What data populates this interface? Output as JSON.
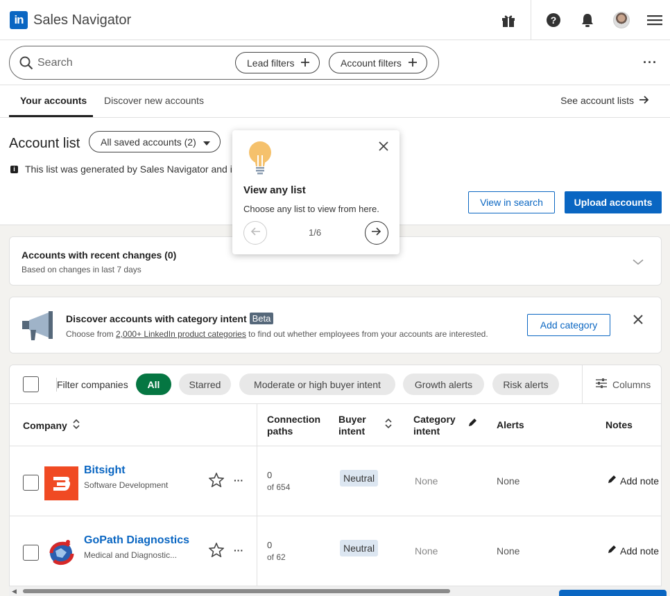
{
  "topbar": {
    "logo_text": "in",
    "app_title": "Sales Navigator"
  },
  "search": {
    "placeholder": "Search",
    "lead_filters": "Lead filters",
    "account_filters": "Account filters"
  },
  "tabs": {
    "your_accounts": "Your accounts",
    "discover": "Discover new accounts",
    "see_lists": "See account lists"
  },
  "account_list": {
    "title": "Account list",
    "dropdown_label": "All saved accounts (2)",
    "info_text": "This list was generated by Sales Navigator and in",
    "view_in_search": "View in search",
    "upload_accounts": "Upload accounts"
  },
  "popover": {
    "title": "View any list",
    "body": "Choose any list to view from here.",
    "counter": "1/6"
  },
  "recent_changes": {
    "title": "Accounts with recent changes (0)",
    "subtitle": "Based on changes in last 7 days"
  },
  "category_intent": {
    "title": "Discover accounts with category intent",
    "badge": "Beta",
    "sub_prefix": "Choose from ",
    "sub_link": "2,000+ LinkedIn product categories",
    "sub_suffix": " to find out whether employees from your accounts are interested.",
    "add_button": "Add category"
  },
  "filters": {
    "label": "Filter companies",
    "chips": [
      "All",
      "Starred",
      "Moderate or high buyer intent",
      "Growth alerts",
      "Risk alerts"
    ],
    "columns_label": "Columns"
  },
  "table": {
    "headers": {
      "company": "Company",
      "connection_paths": [
        "Connection",
        "paths"
      ],
      "buyer_intent": [
        "Buyer",
        "intent"
      ],
      "category_intent": [
        "Category",
        "intent"
      ],
      "alerts": "Alerts",
      "notes": "Notes"
    },
    "rows": [
      {
        "name": "Bitsight",
        "industry": "Software Development",
        "connections": "0",
        "connections_of": "of 654",
        "buyer_intent": "Neutral",
        "category_intent": "None",
        "alerts": "None",
        "note_action": "Add note"
      },
      {
        "name": "GoPath Diagnostics",
        "industry": "Medical and Diagnostic...",
        "connections": "0",
        "connections_of": "of 62",
        "buyer_intent": "Neutral",
        "category_intent": "None",
        "alerts": "None",
        "note_action": "Add note"
      }
    ]
  },
  "colors": {
    "brand_blue": "#0a66c2",
    "active_chip_green": "#057642",
    "bitsight_orange": "#f04a23"
  }
}
